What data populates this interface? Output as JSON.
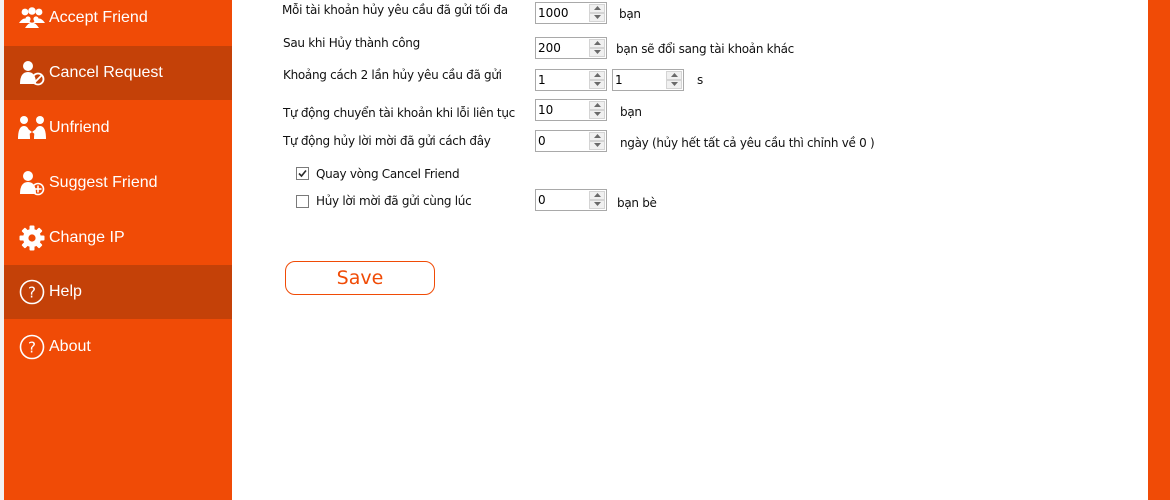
{
  "sidebar": {
    "items": [
      {
        "label": "Accept Friend",
        "icon": "group-users-icon"
      },
      {
        "label": "Cancel Request",
        "icon": "user-cancel-icon"
      },
      {
        "label": "Unfriend",
        "icon": "user-unfriend-icon"
      },
      {
        "label": "Suggest Friend",
        "icon": "user-add-icon"
      },
      {
        "label": "Change IP",
        "icon": "gear-icon"
      },
      {
        "label": "Help",
        "icon": "question-circle-icon"
      },
      {
        "label": "About",
        "icon": "question-circle-icon"
      }
    ],
    "active_item": "Cancel Request",
    "hover_item": "Help"
  },
  "colors": {
    "accent": "#f04b06",
    "accent_dark": "#c44108",
    "text_white": "#ffffff"
  },
  "form": {
    "max_cancel": {
      "label": "Mỗi tài khoản hủy yêu cầu đã gửi tối đa",
      "value": "1000",
      "suffix": "bạn"
    },
    "after_cancel": {
      "label": "Sau khi Hủy thành công",
      "value": "200",
      "suffix": "bạn sẽ đổi sang tài khoản khác"
    },
    "interval": {
      "label": "Khoảng cách 2 lần hủy yêu cầu đã gửi",
      "value_from": "1",
      "value_to": "1",
      "suffix": "s"
    },
    "auto_switch": {
      "label": "Tự động chuyển tài khoản khi lỗi liên tục",
      "value": "10",
      "suffix": "bạn"
    },
    "auto_cancel_days": {
      "label": "Tự động hủy lời mời đã gửi cách đây",
      "value": "0",
      "suffix": "ngày (hủy hết tất cả yêu cầu thì chỉnh về 0 )"
    },
    "loop_cancel": {
      "label": "Quay vòng Cancel Friend",
      "checked": true
    },
    "simultaneous": {
      "label": "Hủy lời mời đã gửi cùng lúc",
      "checked": false,
      "value": "0",
      "suffix": "bạn bè"
    },
    "save_label": "Save"
  }
}
